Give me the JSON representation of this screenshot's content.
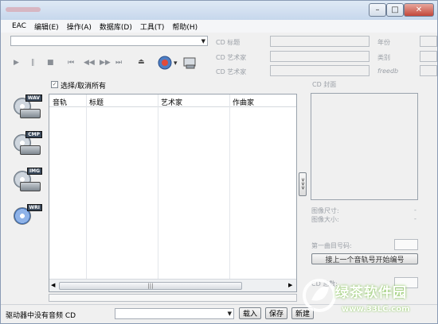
{
  "window": {
    "minimize": "–",
    "maximize": "□",
    "close": "✕"
  },
  "menu": [
    "EAC",
    "编辑(E)",
    "操作(A)",
    "数据库(D)",
    "工具(T)",
    "帮助(H)"
  ],
  "toolbar": {
    "drive_select": "",
    "play": "▶",
    "pause": "‖",
    "stop": "■",
    "prev_track": "⏮",
    "rewind": "◀◀",
    "forward": "▶▶",
    "next_track": "⏭",
    "eject": "⏏",
    "cd_dropdown": "▾"
  },
  "cd_info": {
    "title_label": "CD 标题",
    "artist_label": "CD 艺术家",
    "artist2_label": "CD 艺术家",
    "year_label": "年份",
    "genre_label": "类别",
    "freedb_label": "freedb"
  },
  "select_all_label": "选择/取消所有",
  "side_icons": [
    {
      "name": "wav",
      "tag": "WAV"
    },
    {
      "name": "cmp",
      "tag": "CMP"
    },
    {
      "name": "img",
      "tag": "IMG"
    },
    {
      "name": "wri",
      "tag": "WRI"
    }
  ],
  "tracklist": {
    "columns": [
      "音轨",
      "标题",
      "艺术家",
      "作曲家"
    ],
    "rows": [],
    "scroll_thumb": "|||"
  },
  "cover": {
    "heading": "CD 封面",
    "image_size_label": "图像尺寸:",
    "image_bytes_label": "图像大小:",
    "image_size_value": "-",
    "image_bytes_value": "-",
    "first_track_label": "第一曲目号码:",
    "continue_button": "接上一个音轨号开始编号",
    "cd_count_label": "CD 总数:",
    "expand_button": ">>>"
  },
  "status": {
    "text": "驱动器中没有音频 CD",
    "load_button": "载入",
    "save_button": "保存",
    "new_button": "新建"
  },
  "watermark": {
    "brand": "绿茶软件园",
    "url": "www.33LC.com",
    "color": "#7ac143"
  }
}
